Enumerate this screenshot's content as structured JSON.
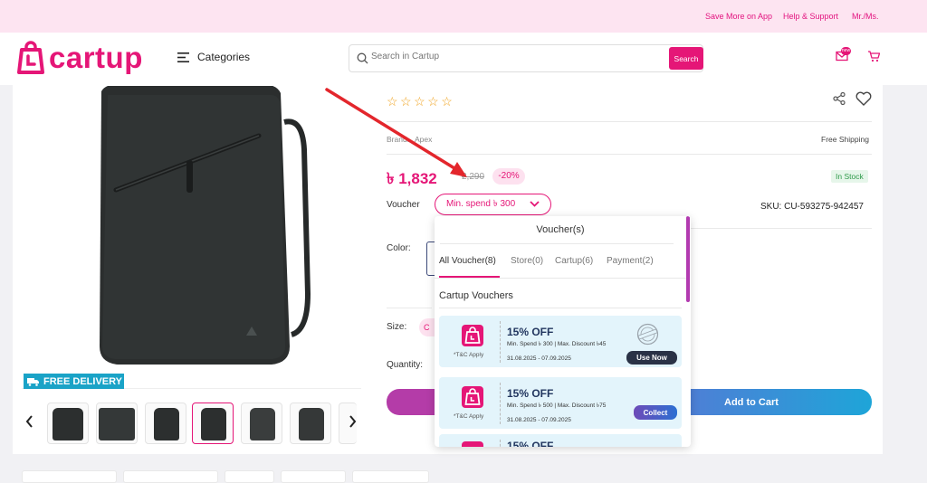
{
  "topbar": {
    "links": [
      "Save More on App",
      "Help & Support",
      "Mr./Ms."
    ]
  },
  "header": {
    "brand": "cartup",
    "categories_label": "Categories",
    "search_placeholder": "Search in Cartup",
    "search_button": "Search",
    "mail_badge": "new"
  },
  "gallery": {
    "free_delivery": "FREE DELIVERY",
    "thumbnail_count": 6,
    "active_thumbnail": 4
  },
  "product": {
    "rating_stars": "☆☆☆☆☆",
    "brand_label": "Brand:",
    "brand_value": "Apex",
    "shipping": "Free Shipping",
    "price": "৳ 1,832",
    "old_price": "2,290",
    "discount": "-20%",
    "stock": "In Stock",
    "voucher_label": "Voucher",
    "voucher_chip": "Min. spend ৳ 300",
    "sku": "SKU: CU-593275-942457",
    "color_label": "Color:",
    "size_label": "Size:",
    "size_chip": "C",
    "quantity_label": "Quantity:",
    "add_to_cart": "Add to Cart"
  },
  "voucher_popup": {
    "title": "Voucher(s)",
    "tabs": [
      "All Voucher(8)",
      "Store(0)",
      "Cartup(6)",
      "Payment(2)"
    ],
    "group_title": "Cartup Vouchers",
    "vouchers": [
      {
        "off": "15% OFF",
        "condition": "Min. Spend ৳ 300 | Max. Discount ৳45",
        "dates": "31.08.2025 - 07.09.2025",
        "tc": "*T&C Apply",
        "button": "Use Now"
      },
      {
        "off": "15% OFF",
        "condition": "Min. Spend ৳ 500 | Max. Discount ৳75",
        "dates": "31.08.2025 - 07.09.2025",
        "tc": "*T&C Apply",
        "button": "Collect"
      },
      {
        "off": "15% OFF"
      }
    ]
  },
  "colors": {
    "brand": "#e51677",
    "topbar_bg": "#fde4f1",
    "free_delivery": "#1aa3c7"
  }
}
